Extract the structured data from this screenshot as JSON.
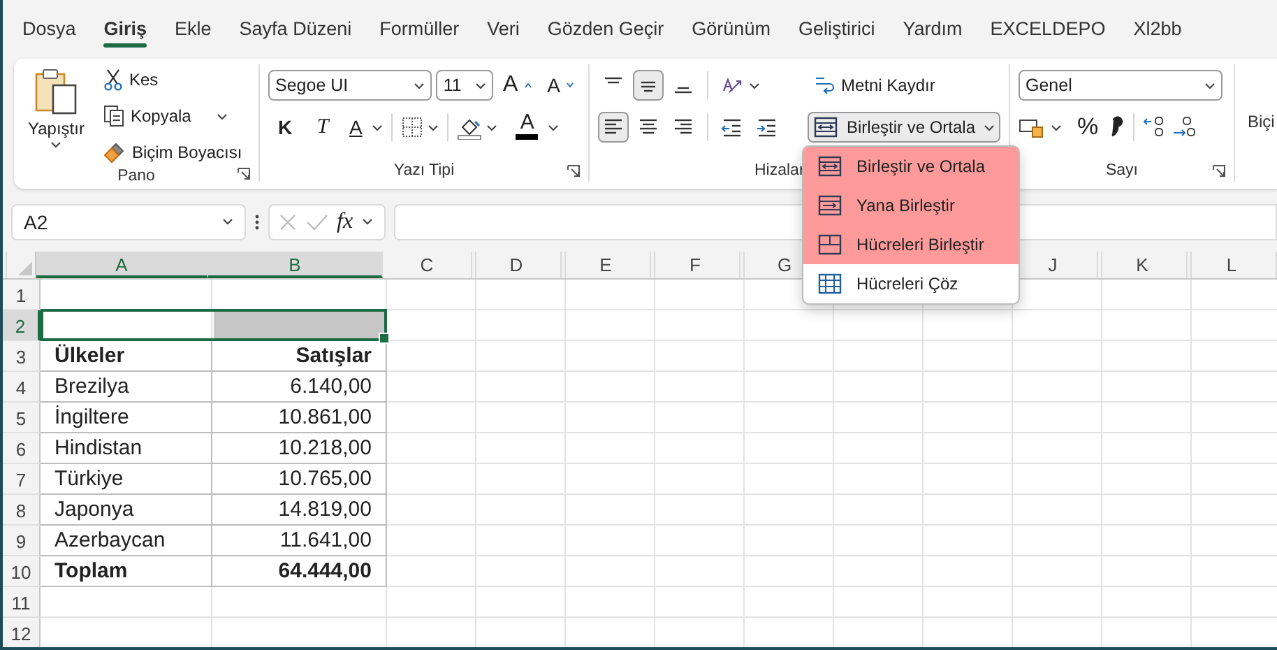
{
  "tabs": [
    {
      "label": "Dosya",
      "selected": false
    },
    {
      "label": "Giriş",
      "selected": true
    },
    {
      "label": "Ekle",
      "selected": false
    },
    {
      "label": "Sayfa Düzeni",
      "selected": false
    },
    {
      "label": "Formüller",
      "selected": false
    },
    {
      "label": "Veri",
      "selected": false
    },
    {
      "label": "Gözden Geçir",
      "selected": false
    },
    {
      "label": "Görünüm",
      "selected": false
    },
    {
      "label": "Geliştirici",
      "selected": false
    },
    {
      "label": "Yardım",
      "selected": false
    },
    {
      "label": "EXCELDEPO",
      "selected": false
    },
    {
      "label": "Xl2bb",
      "selected": false
    }
  ],
  "clipboard": {
    "paste": "Yapıştır",
    "cut": "Kes",
    "copy": "Kopyala",
    "format_painter": "Biçim Boyacısı",
    "group_label": "Pano"
  },
  "font": {
    "family": "Segoe UI",
    "size": "11",
    "grow": "A",
    "shrink": "A",
    "bold": "K",
    "italic": "T",
    "underline": "A",
    "font_color": "A",
    "group_label": "Yazı Tipi"
  },
  "alignment": {
    "buttons": [
      {
        "kind": "top",
        "selected": false
      },
      {
        "kind": "middle",
        "selected": true
      },
      {
        "kind": "bottom",
        "selected": false
      },
      {
        "kind": "orientation",
        "selected": false
      },
      {
        "kind": "left",
        "selected": true
      },
      {
        "kind": "center",
        "selected": false
      },
      {
        "kind": "right",
        "selected": false
      },
      {
        "kind": "outdent",
        "selected": false
      },
      {
        "kind": "indent",
        "selected": false
      }
    ],
    "wrap_text": "Metni Kaydır",
    "merge": "Birleştir ve Ortala",
    "group_label": "Hizalar"
  },
  "number": {
    "format": "Genel",
    "percent": "%",
    "group_label": "Sayı"
  },
  "next_group_label": "Biçi",
  "merge_menu": [
    {
      "label": "Birleştir ve Ortala",
      "kind": "merge_center",
      "highlighted": true
    },
    {
      "label": "Yana Birleştir",
      "kind": "merge_across",
      "highlighted": true
    },
    {
      "label": "Hücreleri Birleştir",
      "kind": "merge_cells",
      "highlighted": true
    },
    {
      "label": "Hücreleri Çöz",
      "kind": "unmerge",
      "highlighted": false
    }
  ],
  "name_box": "A2",
  "formula_bar": {
    "fx": "fx"
  },
  "columns": [
    {
      "label": "A",
      "selected": true
    },
    {
      "label": "B",
      "selected": true
    },
    {
      "label": "C",
      "selected": false
    },
    {
      "label": "D",
      "selected": false
    },
    {
      "label": "E",
      "selected": false
    },
    {
      "label": "F",
      "selected": false
    },
    {
      "label": "G",
      "selected": false
    },
    {
      "label": "J",
      "selected": false
    },
    {
      "label": "K",
      "selected": false
    },
    {
      "label": "L",
      "selected": false
    }
  ],
  "rows": [
    {
      "number": "1",
      "selected": false
    },
    {
      "number": "2",
      "selected": true
    },
    {
      "number": "3",
      "selected": false,
      "bold": true,
      "cells": [
        "Ülkeler",
        "Satışlar"
      ]
    },
    {
      "number": "4",
      "selected": false,
      "bold": false,
      "cells": [
        "Brezilya",
        "6.140,00"
      ]
    },
    {
      "number": "5",
      "selected": false,
      "bold": false,
      "cells": [
        "İngiltere",
        "10.861,00"
      ]
    },
    {
      "number": "6",
      "selected": false,
      "bold": false,
      "cells": [
        "Hindistan",
        "10.218,00"
      ]
    },
    {
      "number": "7",
      "selected": false,
      "bold": false,
      "cells": [
        "Türkiye",
        "10.765,00"
      ]
    },
    {
      "number": "8",
      "selected": false,
      "bold": false,
      "cells": [
        "Japonya",
        "14.819,00"
      ]
    },
    {
      "number": "9",
      "selected": false,
      "bold": false,
      "cells": [
        "Azerbaycan",
        "11.641,00"
      ]
    },
    {
      "number": "10",
      "selected": false,
      "bold": true,
      "cells": [
        "Toplam",
        "64.444,00"
      ]
    },
    {
      "number": "11",
      "selected": false
    },
    {
      "number": "12",
      "selected": false
    }
  ]
}
